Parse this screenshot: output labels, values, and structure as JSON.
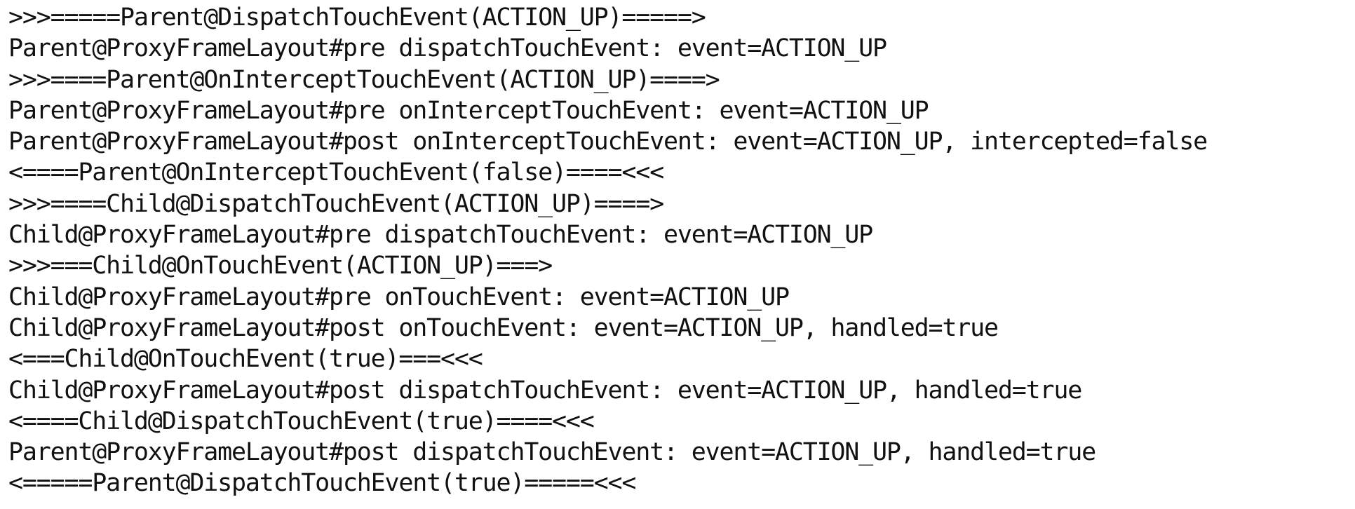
{
  "log": {
    "lines": [
      ">>>=====Parent@DispatchTouchEvent(ACTION_UP)=====>",
      "Parent@ProxyFrameLayout#pre dispatchTouchEvent: event=ACTION_UP",
      ">>>====Parent@OnInterceptTouchEvent(ACTION_UP)====>",
      "Parent@ProxyFrameLayout#pre onInterceptTouchEvent: event=ACTION_UP",
      "Parent@ProxyFrameLayout#post onInterceptTouchEvent: event=ACTION_UP, intercepted=false",
      "<====Parent@OnInterceptTouchEvent(false)====<<<",
      ">>>====Child@DispatchTouchEvent(ACTION_UP)====>",
      "Child@ProxyFrameLayout#pre dispatchTouchEvent: event=ACTION_UP",
      ">>>===Child@OnTouchEvent(ACTION_UP)===>",
      "Child@ProxyFrameLayout#pre onTouchEvent: event=ACTION_UP",
      "Child@ProxyFrameLayout#post onTouchEvent: event=ACTION_UP, handled=true",
      "<===Child@OnTouchEvent(true)===<<<",
      "Child@ProxyFrameLayout#post dispatchTouchEvent: event=ACTION_UP, handled=true",
      "<====Child@DispatchTouchEvent(true)====<<<",
      "Parent@ProxyFrameLayout#post dispatchTouchEvent: event=ACTION_UP, handled=true",
      "<=====Parent@DispatchTouchEvent(true)=====<<<"
    ]
  }
}
